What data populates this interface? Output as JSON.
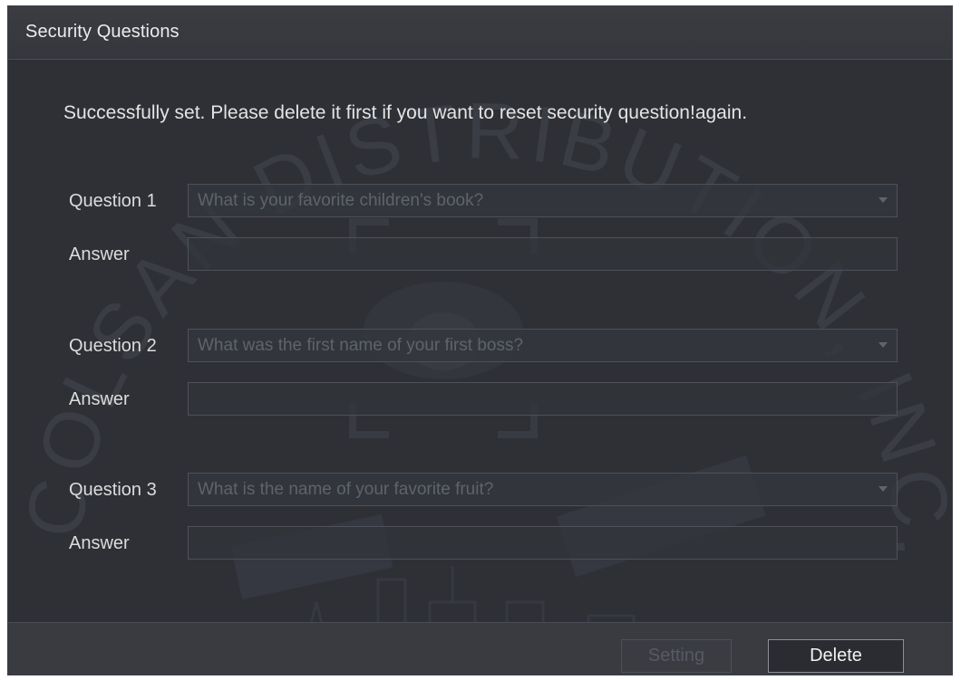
{
  "dialog": {
    "title": "Security Questions",
    "message": "Successfully set. Please delete it first if you want to reset security question!again."
  },
  "questions": [
    {
      "label": "Question 1",
      "selected": "What is your favorite children's book?",
      "answer_label": "Answer",
      "answer_value": ""
    },
    {
      "label": "Question 2",
      "selected": "What was the first name of your first boss?",
      "answer_label": "Answer",
      "answer_value": ""
    },
    {
      "label": "Question 3",
      "selected": "What is the name of your favorite fruit?",
      "answer_label": "Answer",
      "answer_value": ""
    }
  ],
  "footer": {
    "disabled_label": "Setting",
    "delete_label": "Delete"
  },
  "watermark": {
    "text": "COLSAN DISTRIBUTION, INC."
  },
  "colors": {
    "dialog_bg": "#2e3036",
    "titlebar_bg": "#3a3c42",
    "footer_bg": "#393b41",
    "field_border": "#4e5159",
    "text_primary": "#e4e4e4",
    "text_disabled": "#5f636b"
  }
}
